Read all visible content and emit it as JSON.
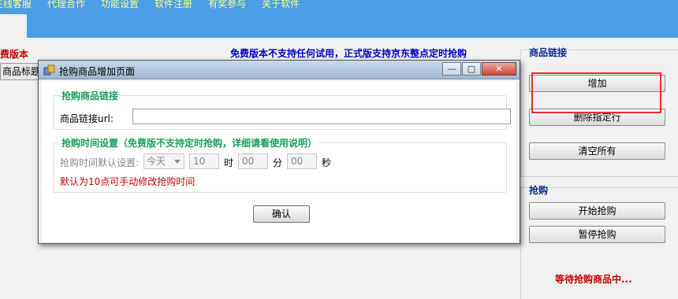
{
  "menu": {
    "items": [
      "在线客服",
      "代理合作",
      "功能设置",
      "软件注册",
      "有奖参与",
      "关于软件"
    ]
  },
  "main": {
    "version_label": "费版本",
    "column_header": "商品标题",
    "notice": "免费版本不支持任何试用，正式版支持京东整点定时抢购"
  },
  "panel_link": {
    "title": "商品链接",
    "add_button": "增加",
    "delete_button": "删除指定行",
    "clear_button": "清空所有"
  },
  "panel_buy": {
    "title": "抢购",
    "start_button": "开始抢购",
    "pause_button": "暂停抢购",
    "status": "等待抢购商品中..."
  },
  "dialog": {
    "title": "抢购商品增加页面",
    "link_group_title": "抢购商品链接",
    "url_label": "商品链接url:",
    "url_value": "",
    "time_group_title": "抢购时间设置（免费版不支持定时抢购，详细请看使用说明）",
    "default_time_label": "抢购时间默认设置:",
    "day_select_value": "今天",
    "hour_value": "10",
    "hour_unit": "时",
    "minute_value": "00",
    "minute_unit": "分",
    "second_value": "00",
    "second_unit": "秒",
    "hint": "默认为10点可手动修改抢购时间",
    "confirm_button": "确认"
  },
  "colors": {
    "menu_bar": "#4a9ee6",
    "menu_text": "#ffff80",
    "notice_text": "#0000cc",
    "group_title": "#1aa05a",
    "warning_text": "#cc0000",
    "highlight_box": "#e8302a"
  }
}
